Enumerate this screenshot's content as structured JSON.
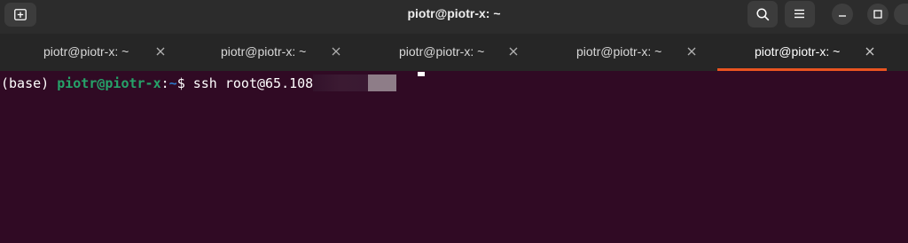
{
  "window": {
    "title": "piotr@piotr-x: ~"
  },
  "icons": {
    "new_tab": "new-tab-icon",
    "search": "search-icon",
    "menu": "hamburger-menu-icon",
    "minimize": "minimize-icon",
    "maximize": "maximize-icon",
    "close": "close-icon"
  },
  "tabs": [
    {
      "label": "piotr@piotr-x: ~",
      "active": false
    },
    {
      "label": "piotr@piotr-x: ~",
      "active": false
    },
    {
      "label": "piotr@piotr-x: ~",
      "active": false
    },
    {
      "label": "piotr@piotr-x: ~",
      "active": false
    },
    {
      "label": "piotr@piotr-x: ~",
      "active": true
    }
  ],
  "terminal": {
    "env_prefix": "(base) ",
    "user_host": "piotr@piotr-x",
    "separator": ":",
    "cwd": "~",
    "prompt_symbol": "$ ",
    "command": "ssh root@65.108"
  },
  "colors": {
    "terminal_bg": "#300a24",
    "accent": "#e95420",
    "user_host": "#26a269",
    "cwd": "#2d78c8"
  }
}
